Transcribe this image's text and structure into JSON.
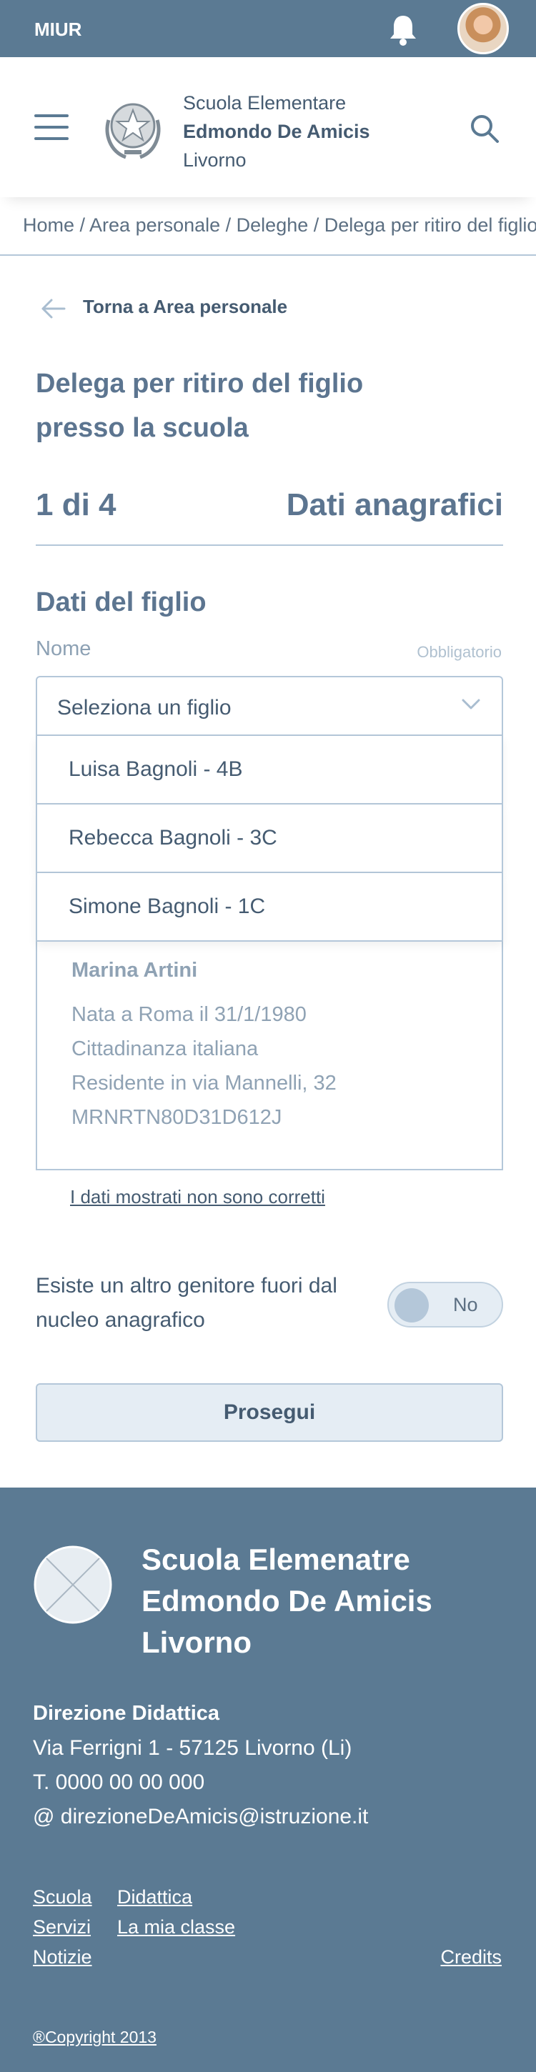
{
  "topbar": {
    "brand": "MIUR",
    "notification_icon": "bell-icon",
    "avatar_icon": "user-avatar"
  },
  "header": {
    "school_line1": "Scuola Elementare",
    "school_line2": "Edmondo De Amicis",
    "school_line3": "Livorno",
    "menu_icon": "hamburger-icon",
    "emblem_icon": "republic-emblem-icon",
    "search_icon": "search-icon"
  },
  "breadcrumb": "Home / Area personale / Deleghe / Delega per ritiro del figlio presso la scuola",
  "back_link": {
    "label": "Torna a Area personale",
    "icon": "arrow-left-icon"
  },
  "page_title": "Delega per ritiro del figlio presso la scuola",
  "stepper": {
    "current": "1 di 4",
    "step_name": "Dati anagrafici"
  },
  "section": {
    "title": "Dati del figlio"
  },
  "field": {
    "label": "Nome",
    "required": "Obbligatorio"
  },
  "select": {
    "value": "Seleziona un figlio",
    "options": [
      "Luisa Bagnoli - 4B",
      "Rebecca Bagnoli - 3C",
      "Simone Bagnoli - 1C"
    ]
  },
  "person_card": {
    "name": "Marina Artini",
    "lines": [
      "Nata a Roma il 31/1/1980",
      "Cittadinanza italiana",
      "Residente in via Mannelli, 32",
      "MRNRTN80D31D612J"
    ]
  },
  "wrong_data_link": "I dati mostrati non sono corretti",
  "other_parent": {
    "label": "Esiste un altro genitore fuori dal nucleo anagrafico",
    "state": "No"
  },
  "continue_button": "Prosegui",
  "footer": {
    "school_line1": "Scuola Elemenatre",
    "school_line2": "Edmondo De Amicis",
    "school_line3": "Livorno",
    "direction_title": "Direzione Didattica",
    "address": "Via Ferrigni 1 - 57125 Livorno (Li)",
    "phone": "T. 0000 00 00 000",
    "email": "@ direzioneDeAmicis@istruzione.it",
    "links": {
      "scuola": "Scuola",
      "didattica": "Didattica",
      "servizi": "Servizi",
      "mia_classe": "La mia classe",
      "notizie": "Notizie",
      "credits": "Credits"
    },
    "copyright": "®Copyright 2013"
  },
  "colors": {
    "primary": "#5b7a93",
    "text": "#455b71",
    "border": "#b4c7d9",
    "button_bg": "#e5edf4"
  }
}
